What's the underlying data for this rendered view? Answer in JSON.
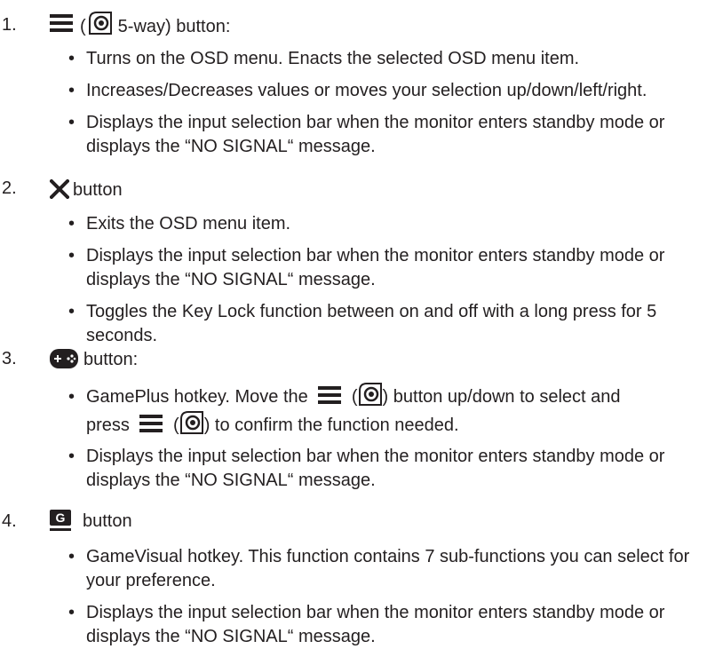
{
  "items": [
    {
      "number": "1.",
      "paren_open": "(",
      "head_text": "5-way) button:",
      "bullets": [
        "Turns on the OSD menu. Enacts the selected OSD menu item.",
        "Increases/Decreases values or moves your selection up/down/left/right.",
        "Displays the input selection bar when the monitor  enters standby mode or displays the “NO SIGNAL“ message."
      ]
    },
    {
      "number": "2.",
      "head_text": "button",
      "bullets": [
        "Exits the OSD menu item.",
        "Displays the input selection bar when the monitor  enters standby mode or displays the “NO SIGNAL“ message.",
        "Toggles the Key Lock function between on and off with a long press for 5 seconds."
      ]
    },
    {
      "number": "3.",
      "head_text": "button:",
      "bullet1": {
        "a": "GamePlus hotkey. Move the",
        "b": "(",
        "c": ") button up/down to select and",
        "d": "press",
        "e": "(",
        "f": ") to confirm the function needed."
      },
      "bullet2": "Displays the input selection bar when the monitor  enters standby mode or displays the “NO SIGNAL“ message."
    },
    {
      "number": "4.",
      "head_text": "button",
      "g_icon_letter": "G",
      "bullets": [
        "GameVisual hotkey. This function contains 7 sub-functions you can select for your preference.",
        "Displays the input selection bar when the monitor  enters standby mode or displays the “NO SIGNAL“ message."
      ]
    }
  ],
  "icons": [
    "menu-icon",
    "five-way-joystick-icon",
    "close-x-icon",
    "gamepad-icon",
    "gamevisual-icon"
  ]
}
